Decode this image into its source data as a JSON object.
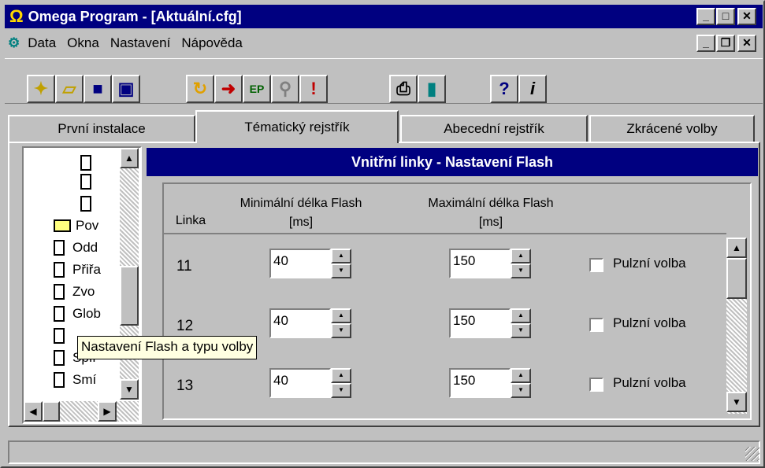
{
  "window": {
    "title": "Omega Program - [Aktuální.cfg]",
    "app_icon": "Ω"
  },
  "menu": {
    "items": [
      {
        "label": "Data"
      },
      {
        "label": "Okna"
      },
      {
        "label": "Nastavení"
      },
      {
        "label": "Nápověda"
      }
    ]
  },
  "toolbar": {
    "buttons": [
      "new-icon",
      "open-folder-icon",
      "save-icon",
      "save-as-icon",
      "download-icon",
      "upload-icon",
      "ep-icon",
      "search-icon",
      "alert-icon",
      "print-icon",
      "exit-door-icon",
      "help-icon",
      "info-icon"
    ]
  },
  "tabs": [
    {
      "label": "První instalace"
    },
    {
      "label": "Tématický rejstřík",
      "active": true
    },
    {
      "label": "Abecední rejstřík"
    },
    {
      "label": "Zkrácené volby"
    }
  ],
  "tree": {
    "items": [
      {
        "label": "",
        "icon": "document-icon"
      },
      {
        "label": "",
        "icon": "document-icon"
      },
      {
        "label": "",
        "icon": "document-icon"
      },
      {
        "label": "Pov",
        "icon": "folder-icon"
      },
      {
        "label": "Odd",
        "icon": "document-icon"
      },
      {
        "label": "Přiřa",
        "icon": "document-icon"
      },
      {
        "label": "Zvo",
        "icon": "document-icon"
      },
      {
        "label": "Glob",
        "icon": "document-icon"
      },
      {
        "label": "",
        "icon": "document-icon"
      },
      {
        "label": "Spír",
        "icon": "document-icon"
      },
      {
        "label": "Smí",
        "icon": "document-icon"
      }
    ],
    "tooltip": "Nastavení Flash a typu volby"
  },
  "panel": {
    "header": "Vnitřní linky - Nastavení Flash",
    "col_linka": "Linka",
    "col_min": "Minimální délka Flash",
    "col_min_unit": "[ms]",
    "col_max": "Maximální délka Flash",
    "col_max_unit": "[ms]",
    "rows": [
      {
        "linka": "11",
        "min": "40",
        "max": "150",
        "pulse_label": "Pulzní volba",
        "pulse": false
      },
      {
        "linka": "12",
        "min": "40",
        "max": "150",
        "pulse_label": "Pulzní volba",
        "pulse": false
      },
      {
        "linka": "13",
        "min": "40",
        "max": "150",
        "pulse_label": "Pulzní volba",
        "pulse": false
      }
    ]
  },
  "status": {
    "text": ""
  }
}
